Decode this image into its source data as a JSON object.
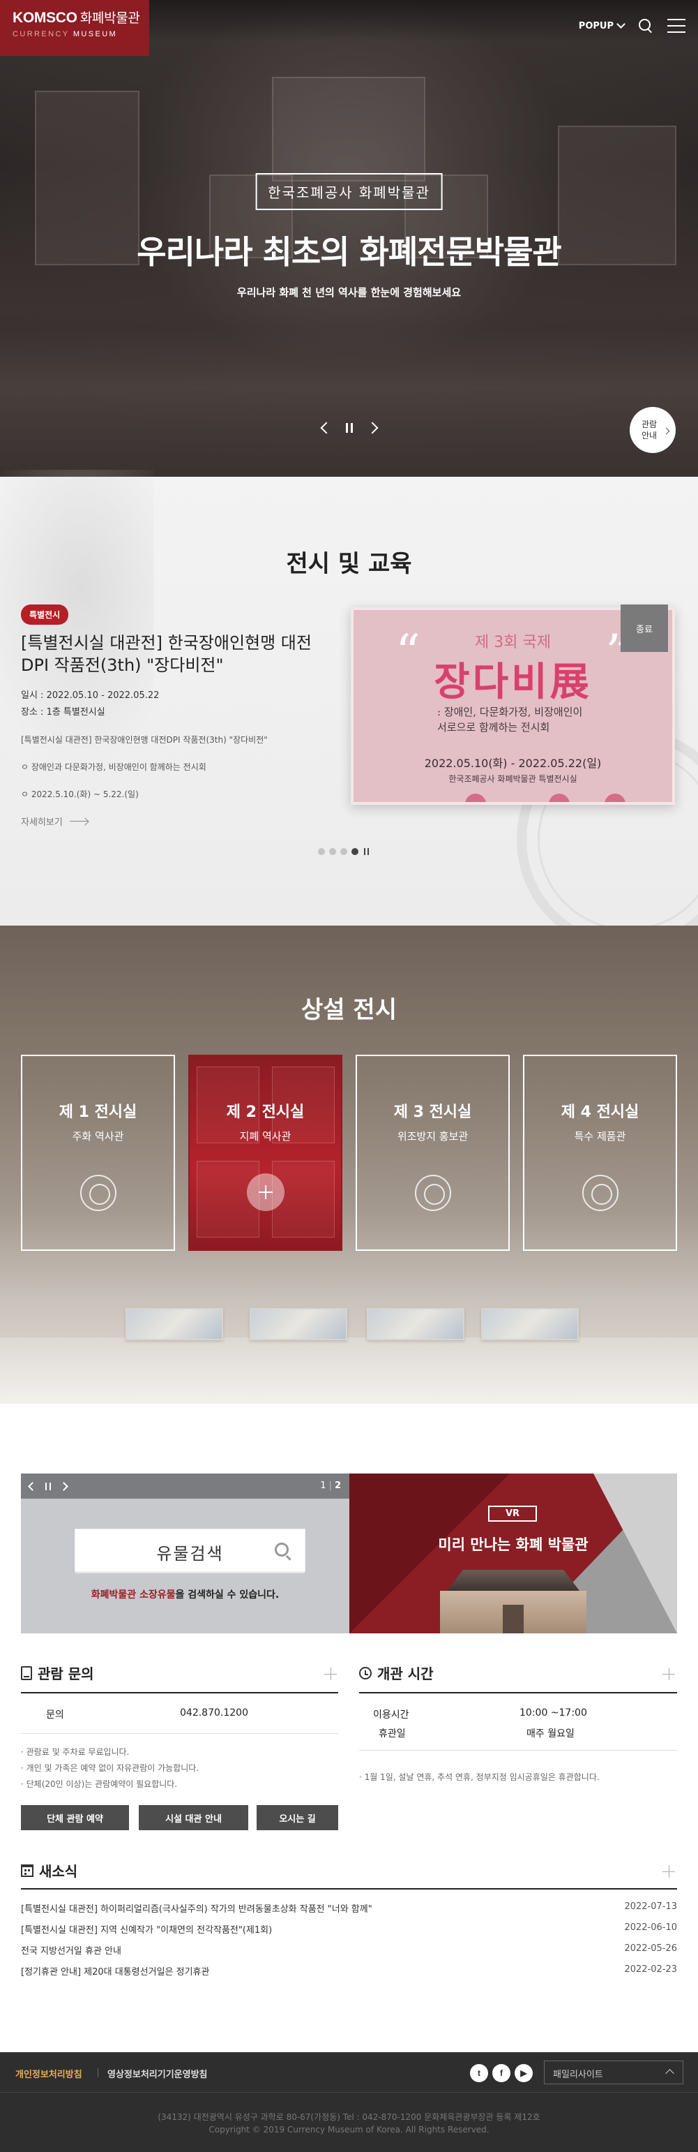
{
  "header": {
    "logo_brand": "KOMSCO",
    "logo_kr": "화폐박물관",
    "logo_sub_a": "CURRENCY",
    "logo_sub_b": "MUSEUM",
    "popup_label": "POPUP"
  },
  "hero": {
    "subtitle": "한국조폐공사 화폐박물관",
    "title": "우리나라 최초의 화폐전문박물관",
    "desc": "우리나라 화폐 천 년의 역사를 한눈에 경험해보세요",
    "visit_button": "관람 안내"
  },
  "exhibition": {
    "section_title": "전시 및 교육",
    "badge": "특별전시",
    "title": "[특별전시실 대관전] 한국장애인현맹 대전DPI 작품전(3th) \"장다비전\"",
    "period": "일시 : 2022.05.10 - 2022.05.22",
    "place": "장소 : 1층 특별전시실",
    "line1": "[특별전시실 대관전] 한국장애인현맹 대전DPI 작품전(3th) \"장다비전\"",
    "line2": "ㅇ 장애인과 다문화가정, 비장애인이 함께하는 전시회",
    "line3": "ㅇ 2022.5.10.(화) ~ 5.22.(일)",
    "more": "자세히보기",
    "status_tag": "종료",
    "poster": {
      "line1": "제 3회 국제",
      "line2": "장다비展",
      "line3a": ": 장애인, 다문화가정, 비장애인이",
      "line3b": "  서로으로 함께하는 전시회",
      "line4": "2022.05.10(화)  -  2022.05.22(일)",
      "line5": "한국조폐공사 화폐박물관 특별전시실"
    },
    "slide_count": 4,
    "active_slide": 4
  },
  "permanent": {
    "section_title": "상설 전시",
    "halls": [
      {
        "name": "제 1 전시실",
        "desc": "주화 역사관"
      },
      {
        "name": "제 2 전시실",
        "desc": "지폐 역사관"
      },
      {
        "name": "제 3 전시실",
        "desc": "위조방지 홍보관"
      },
      {
        "name": "제 4 전시실",
        "desc": "특수 제품관"
      }
    ],
    "active_hall": 2
  },
  "banner": {
    "page_current": "1",
    "page_total": "2",
    "search_title": "유물검색",
    "search_desc_red": "화폐박물관 소장유물",
    "search_desc_rest": "을 검색하실 수 있습니다.",
    "vr_tag": "VR",
    "vr_title": "미리 만나는 화폐 박물관"
  },
  "inquiry": {
    "title": "관람 문의",
    "label": "문의",
    "phone": "042.870.1200",
    "notes": [
      "· 관람료 및 주차료 무료입니다.",
      "· 개인 및 가족은 예약 없이 자유관람이 가능합니다.",
      "· 단체(20인 이상)는 관람예약이 필요합니다."
    ],
    "buttons": [
      "단체 관람 예약",
      "시설 대관 안내",
      "오시는 길"
    ]
  },
  "hours": {
    "title": "개관 시간",
    "rows": [
      {
        "label": "이용시간",
        "value": "10:00 ~17:00"
      },
      {
        "label": "휴관일",
        "value": "매주 월요일"
      }
    ],
    "note": "· 1월 1일, 설날 연휴, 추석 연휴, 정부지정 임시공휴일은 휴관합니다."
  },
  "news": {
    "title": "새소식",
    "items": [
      {
        "title": "[특별전시실 대관전] 하이퍼리얼리즘(극사실주의) 작가의 반려동물초상화 작품전 \"너와 함께\"",
        "date": "2022-07-13"
      },
      {
        "title": "[특별전시실 대관전] 지역 신예작가 \"이채연의 전각작품전\"(제1회)",
        "date": "2022-06-10"
      },
      {
        "title": "전국 지방선거일 휴관 안내",
        "date": "2022-05-26"
      },
      {
        "title": "[정기휴관 안내] 제20대 대통령선거일은 정기휴관",
        "date": "2022-02-23"
      }
    ]
  },
  "footer": {
    "privacy": "개인정보처리방침",
    "cctv": "영상정보처리기기운영방침",
    "social": [
      "t",
      "f",
      "▶"
    ],
    "family_site": "패밀리사이트",
    "address": "(34132) 대전광역시 유성구 과학로 80-67(가정동)   Tel : 042-870-1200   문화체육관광부장관 등록 제12호",
    "copyright": "Copyright © 2019 Currency Museum of Korea. All Rights Reserved."
  }
}
